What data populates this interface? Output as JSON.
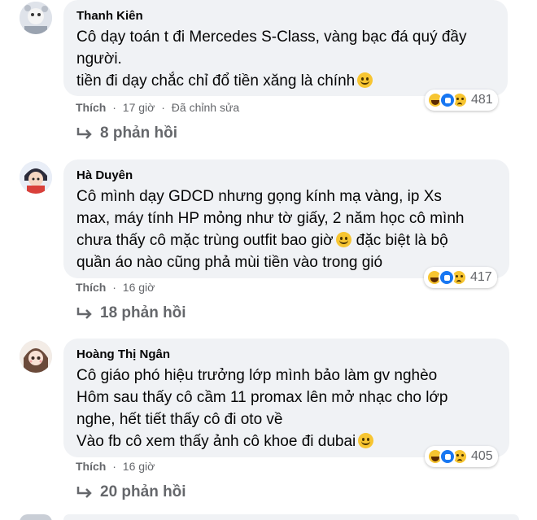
{
  "comments": [
    {
      "author": "Thanh Kiên",
      "lines": [
        "Cô dạy toán t đi Mercedes S-Class, vàng bạc đá quý đầy",
        "người.",
        "tiền đi dạy chắc chỉ đổ tiền xăng là chính"
      ],
      "like_label": "Thích",
      "time": "17 giờ",
      "edited": "Đã chỉnh sửa",
      "reaction_count": "481",
      "replies": "8 phản hồi"
    },
    {
      "author": "Hà Duyên",
      "lines": [
        "Cô mình dạy GDCD nhưng gọng kính mạ vàng, ip Xs",
        "max, máy tính HP mỏng như tờ giấy, 2 năm học cô mình",
        "chưa thấy cô mặc trùng outfit bao giờ",
        "quần áo nào cũng phả mùi tiền vào trong gió"
      ],
      "line3_tail": "đặc biệt là bộ",
      "like_label": "Thích",
      "time": "16 giờ",
      "reaction_count": "417",
      "replies": "18 phản hồi"
    },
    {
      "author": "Hoàng Thị Ngân",
      "lines": [
        "Cô giáo phó hiệu trưởng lớp mình bảo làm gv nghèo",
        "Hôm sau thấy cô cầm 11 promax lên mở nhạc cho lớp",
        "nghe, hết tiết thấy cô đi oto về",
        "Vào fb cô xem thấy ảnh cô khoe đi dubai"
      ],
      "like_label": "Thích",
      "time": "16 giờ",
      "reaction_count": "405",
      "replies": "20 phản hồi"
    }
  ]
}
